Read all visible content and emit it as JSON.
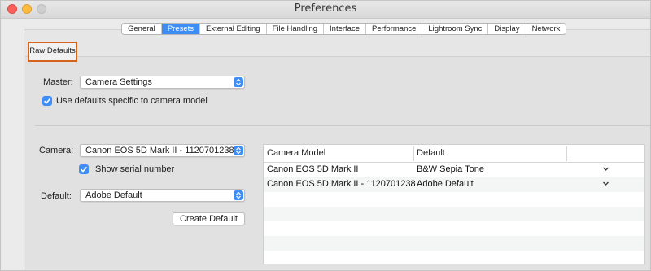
{
  "window": {
    "title": "Preferences"
  },
  "tabs": [
    {
      "label": "General",
      "active": false
    },
    {
      "label": "Presets",
      "active": true
    },
    {
      "label": "External Editing",
      "active": false
    },
    {
      "label": "File Handling",
      "active": false
    },
    {
      "label": "Interface",
      "active": false
    },
    {
      "label": "Performance",
      "active": false
    },
    {
      "label": "Lightroom Sync",
      "active": false
    },
    {
      "label": "Display",
      "active": false
    },
    {
      "label": "Network",
      "active": false
    }
  ],
  "section": {
    "label": "Raw Defaults"
  },
  "master": {
    "label": "Master:",
    "value": "Camera Settings"
  },
  "camera_specific_checkbox": {
    "label": "Use defaults specific to camera model",
    "checked": true
  },
  "camera": {
    "label": "Camera:",
    "value": "Canon EOS 5D Mark II - 1120701238"
  },
  "serial_checkbox": {
    "label": "Show serial number",
    "checked": true
  },
  "default": {
    "label": "Default:",
    "value": "Adobe Default"
  },
  "create_default_button": {
    "label": "Create Default"
  },
  "table": {
    "columns": [
      "Camera Model",
      "Default"
    ],
    "rows": [
      {
        "camera_model": "Canon EOS 5D Mark II",
        "default": "B&W Sepia Tone"
      },
      {
        "camera_model": "Canon EOS 5D Mark II - 1120701238",
        "default": "Adobe Default"
      }
    ]
  },
  "colors": {
    "accent": "#3d8df5",
    "highlight_border": "#d4641c"
  }
}
